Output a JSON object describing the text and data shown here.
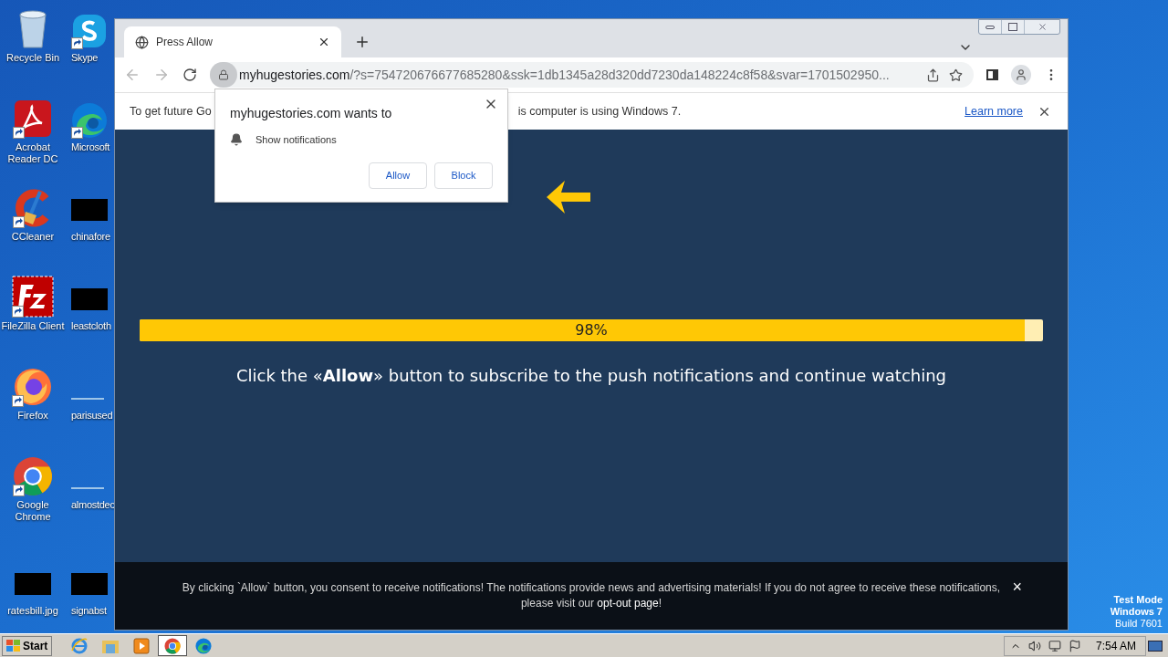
{
  "desktop": {
    "icons": [
      {
        "label": "Recycle Bin",
        "kind": "recycle-bin",
        "shortcut": false
      },
      {
        "label": "Skype",
        "kind": "skype",
        "shortcut": true
      },
      {
        "label": "Acrobat Reader DC",
        "kind": "acrobat",
        "shortcut": true
      },
      {
        "label": "Microsoft",
        "kind": "edge",
        "shortcut": true
      },
      {
        "label": "CCleaner",
        "kind": "ccleaner",
        "shortcut": true
      },
      {
        "label": "chinafore",
        "kind": "redacted",
        "shortcut": false
      },
      {
        "label": "FileZilla Client",
        "kind": "filezilla",
        "shortcut": true
      },
      {
        "label": "leastcloth",
        "kind": "redacted",
        "shortcut": false
      },
      {
        "label": "Firefox",
        "kind": "firefox",
        "shortcut": true
      },
      {
        "label": "parisused",
        "kind": "blank",
        "shortcut": false
      },
      {
        "label": "Google Chrome",
        "kind": "chrome",
        "shortcut": true
      },
      {
        "label": "almostdec",
        "kind": "blank",
        "shortcut": false
      },
      {
        "label": "ratesbill.jpg",
        "kind": "redacted",
        "shortcut": false
      },
      {
        "label": "signabst",
        "kind": "redacted",
        "shortcut": false
      }
    ],
    "watermark": [
      "Test Mode",
      "Windows 7",
      "Build 7601"
    ]
  },
  "browser": {
    "tabs": [
      {
        "title": "Press Allow",
        "selected": true
      }
    ],
    "address": {
      "host": "myhugestories.com",
      "path": "/?s=754720676677685280&ssk=1db1345a28d320dd7230da148224c8f58&svar=1701502950..."
    },
    "infobar": {
      "text_before": "To get future Go",
      "text_after": "is computer is using Windows 7.",
      "link": "Learn more"
    },
    "permission_prompt": {
      "title": "myhugestories.com wants to",
      "permission": "Show notifications",
      "buttons": [
        "Allow",
        "Block"
      ]
    },
    "page": {
      "progress": {
        "level": 0.98,
        "reading": "98%"
      },
      "message": "Click the «**Allow**» button to subscribe to the push notifications and continue watching",
      "consent": {
        "text": "By clicking `Allow` button, you consent to receive notifications! The notifications provide news and advertising materials! If you do not agree to receive these notifications, please visit our ",
        "link": "opt-out page",
        "after": "!",
        "close": "×"
      }
    }
  },
  "taskbar": {
    "start": "Start",
    "apps": [
      {
        "kind": "ie",
        "selected": false
      },
      {
        "kind": "explorer",
        "selected": false
      },
      {
        "kind": "media",
        "selected": false
      },
      {
        "kind": "chrome",
        "selected": true
      },
      {
        "kind": "edge",
        "selected": false
      }
    ],
    "clock": "7:54 AM"
  }
}
